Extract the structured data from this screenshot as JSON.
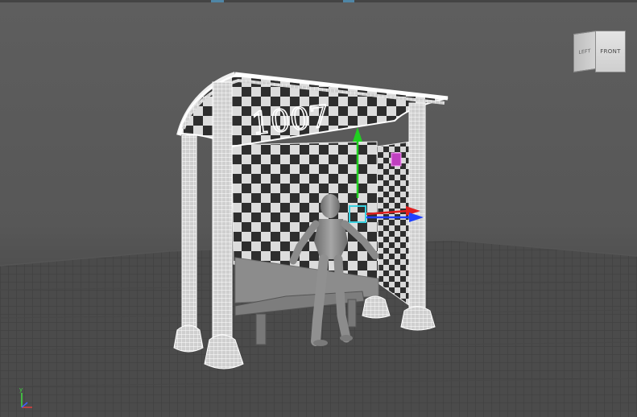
{
  "viewport": {
    "background_color": "#5c5c5c",
    "grid_color": "#3f3f3f",
    "wireframe_color": "#ffffff",
    "character_color": "#8e8e8e"
  },
  "view_cube": {
    "left_face_label": "LEFT",
    "front_face_label": "FRONT"
  },
  "gizmo": {
    "x_axis_color": "#e02020",
    "y_axis_color": "#20d020",
    "z_axis_color": "#2040ff",
    "center_color": "#3ad0e0"
  },
  "axis_indicator": {
    "x_color": "#e04040",
    "y_color": "#40e040",
    "z_color": "#4060ff",
    "y_label": "y"
  },
  "top_toolbar": {
    "accent_color": "#4f86a6"
  },
  "selected_marker_color": "#c040c0"
}
